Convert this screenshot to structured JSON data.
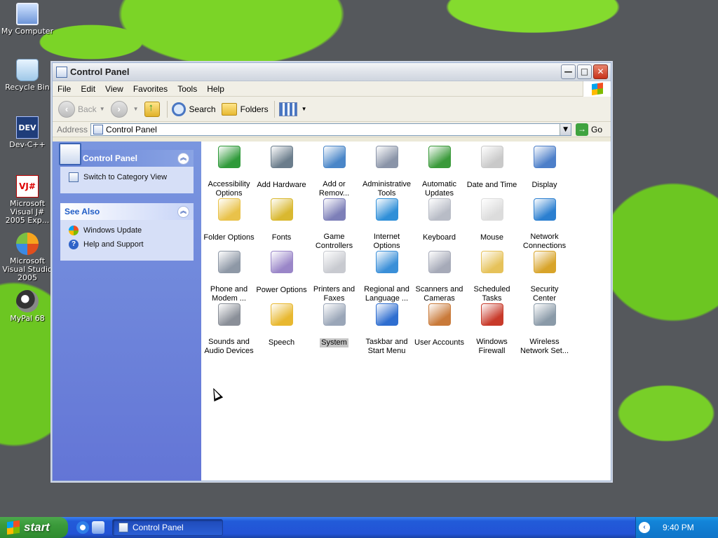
{
  "desktop": {
    "icons": [
      {
        "label": "My Computer",
        "icon": "my-computer-icon"
      },
      {
        "label": "Recycle Bin",
        "icon": "recycle-bin-icon"
      },
      {
        "label": "Dev-C++",
        "icon": "dev-cpp-icon",
        "glyph": "DEV"
      },
      {
        "label": "Microsoft Visual J# 2005 Exp...",
        "icon": "vj-sharp-icon",
        "glyph": "VJ#"
      },
      {
        "label": "Microsoft Visual Studio 2005",
        "icon": "visual-studio-icon"
      },
      {
        "label": "MyPal 68",
        "icon": "mypal-icon"
      }
    ]
  },
  "window": {
    "title": "Control Panel",
    "controls": {
      "minimize": "—",
      "maximize": "□",
      "close": "✕"
    }
  },
  "menubar": {
    "items": [
      "File",
      "Edit",
      "View",
      "Favorites",
      "Tools",
      "Help"
    ]
  },
  "toolbar": {
    "back": "Back",
    "search": "Search",
    "folders": "Folders"
  },
  "address": {
    "label": "Address",
    "value": "Control Panel",
    "go": "Go"
  },
  "taskpane": {
    "main_title": "Control Panel",
    "switch_link": "Switch to Category View",
    "see_also_title": "See Also",
    "see_also_links": [
      "Windows Update",
      "Help and Support"
    ]
  },
  "items": [
    {
      "label": "Accessibility Options",
      "color": "#2f9a3a"
    },
    {
      "label": "Add Hardware",
      "color": "#6b7d8c"
    },
    {
      "label": "Add or Remov...",
      "color": "#4a86c8"
    },
    {
      "label": "Administrative Tools",
      "color": "#8a94a8"
    },
    {
      "label": "Automatic Updates",
      "color": "#3a9a3a"
    },
    {
      "label": "Date and Time",
      "color": "#c9c9c9"
    },
    {
      "label": "Display",
      "color": "#4d7fc9"
    },
    {
      "label": "Folder Options",
      "color": "#e9c24a"
    },
    {
      "label": "Fonts",
      "color": "#d9b830"
    },
    {
      "label": "Game Controllers",
      "color": "#7d7fb8"
    },
    {
      "label": "Internet Options",
      "color": "#2f8fd8"
    },
    {
      "label": "Keyboard",
      "color": "#b8bcc6"
    },
    {
      "label": "Mouse",
      "color": "#dcdcdc"
    },
    {
      "label": "Network Connections",
      "color": "#2b7fd0"
    },
    {
      "label": "Phone and Modem ...",
      "color": "#8e98a6"
    },
    {
      "label": "Power Options",
      "color": "#9a86c8"
    },
    {
      "label": "Printers and Faxes",
      "color": "#c8cad0"
    },
    {
      "label": "Regional and Language ...",
      "color": "#3a8fd8"
    },
    {
      "label": "Scanners and Cameras",
      "color": "#a6aab8"
    },
    {
      "label": "Scheduled Tasks",
      "color": "#e6c25a"
    },
    {
      "label": "Security Center",
      "color": "#d8a42a"
    },
    {
      "label": "Sounds and Audio Devices",
      "color": "#8a8f98"
    },
    {
      "label": "Speech",
      "color": "#e8b830"
    },
    {
      "label": "System",
      "color": "#9aa6b8",
      "selected": true
    },
    {
      "label": "Taskbar and Start Menu",
      "color": "#2f6ed0"
    },
    {
      "label": "User Accounts",
      "color": "#c97a3a"
    },
    {
      "label": "Windows Firewall",
      "color": "#c83a2a"
    },
    {
      "label": "Wireless Network Set...",
      "color": "#8a9aa8"
    }
  ],
  "taskbar": {
    "start": "start",
    "task": "Control Panel",
    "clock": "9:40 PM",
    "help_glyph": "?"
  }
}
